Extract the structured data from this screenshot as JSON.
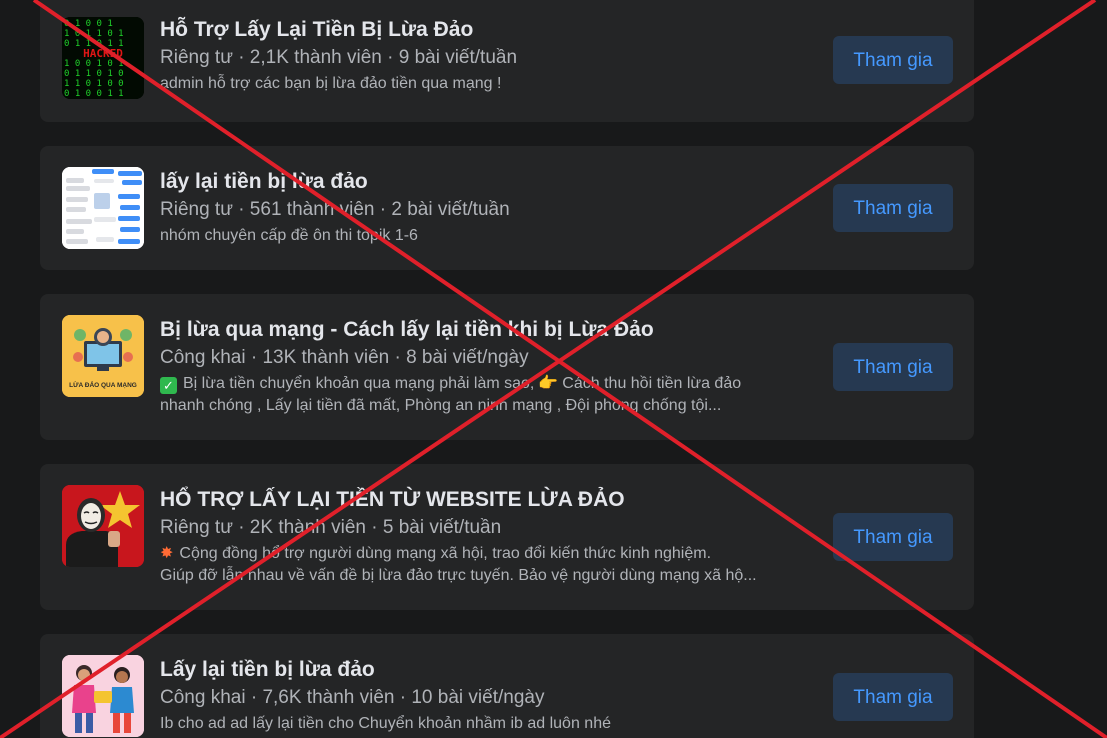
{
  "join_label": "Tham gia",
  "groups": [
    {
      "name": "Hỗ Trợ Lấy Lại Tiền Bị Lừa Đảo",
      "meta": "Riêng tư · 2,1K thành viên · 9 bài viết/tuần",
      "desc1": "admin hỗ trợ các bạn bị lừa đảo tiền qua mạng !",
      "thumb_text": "HACKED"
    },
    {
      "name": "lấy lại tiền bị lừa đảo",
      "meta": "Riêng tư · 561 thành viên · 2 bài viết/tuần",
      "desc1": "nhóm chuyên cấp đề ôn thi topik 1-6"
    },
    {
      "name": "Bị lừa qua mạng - Cách lấy lại tiền khi bị Lừa Đảo",
      "meta": "Công khai · 13K thành viên · 8 bài viết/ngày",
      "desc1a": "Bị lừa tiền chuyển khoản qua mạng phải làm sao,",
      "desc1b": "Cách thu hồi tiền lừa đảo",
      "desc2": "nhanh chóng , Lấy lại tiền đã mất, Phòng an ninh mạng , Đội phòng chống tội...",
      "thumb_text": "LỪA ĐẢO QUA MẠNG"
    },
    {
      "name": "HỔ TRỢ LẤY LẠI TIỀN TỪ WEBSITE LỪA ĐẢO",
      "meta": "Riêng tư · 2K thành viên · 5 bài viết/tuần",
      "desc1": "Cộng đồng hổ trợ người dùng mạng xã hội, trao đổi kiến thức kinh nghiệm.",
      "desc2": "Giúp đỡ lẫn nhau về vấn đề bị lừa đảo trực tuyến. Bảo vệ người dùng mạng xã hộ..."
    },
    {
      "name": "Lấy lại tiền bị lừa đảo",
      "meta": "Công khai · 7,6K thành viên · 10 bài viết/ngày",
      "desc1": "Ib cho ad ad lấy lại tiền cho Chuyển khoản nhầm ib ad luôn nhé"
    }
  ],
  "colors": {
    "background": "#18191a",
    "card": "#242526",
    "button_bg": "#263951",
    "button_text": "#4599ff",
    "cross": "#e0202a"
  }
}
